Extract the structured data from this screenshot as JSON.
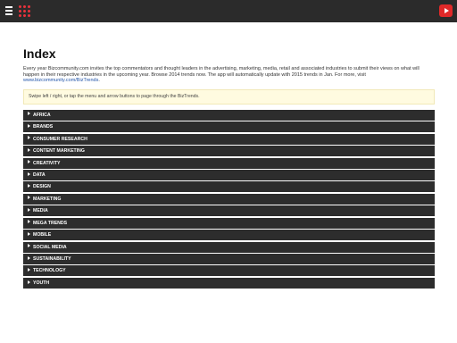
{
  "header": {
    "menu_icon": "hamburger-menu-icon",
    "logo": "bizcommunity-logo",
    "video_icon": "youtube-play-icon"
  },
  "page": {
    "title": "Index",
    "intro_text": "Every year Bizcommunity.com invites the top commentators and thought leaders in the advertising, marketing, media, retail and associated industries to submit their views on what will happen in their respective industries in the upcoming year. Browse 2014 trends now. The app will automatically update with 2015 trends in Jan. For more, visit ",
    "intro_link": "www.bizcommunity.com/BizTrends",
    "intro_end": ".",
    "notice": "Swipe left / right, or tap the menu and arrow buttons to page through the BizTrends."
  },
  "categories": [
    "AFRICA",
    "BRANDS",
    "CONSUMER RESEARCH",
    "CONTENT MARKETING",
    "CREATIVITY",
    "DATA",
    "DESIGN",
    "MARKETING",
    "MEDIA",
    "MEGA TRENDS",
    "MOBILE",
    "SOCIAL MEDIA",
    "SUSTAINABILITY",
    "TECHNOLOGY",
    "YOUTH"
  ],
  "colors": {
    "topbar": "#2b2b2b",
    "accent": "#e8323c",
    "item_bg": "#2d2d2d",
    "notice_bg": "#fffbe0",
    "link": "#2255aa"
  }
}
